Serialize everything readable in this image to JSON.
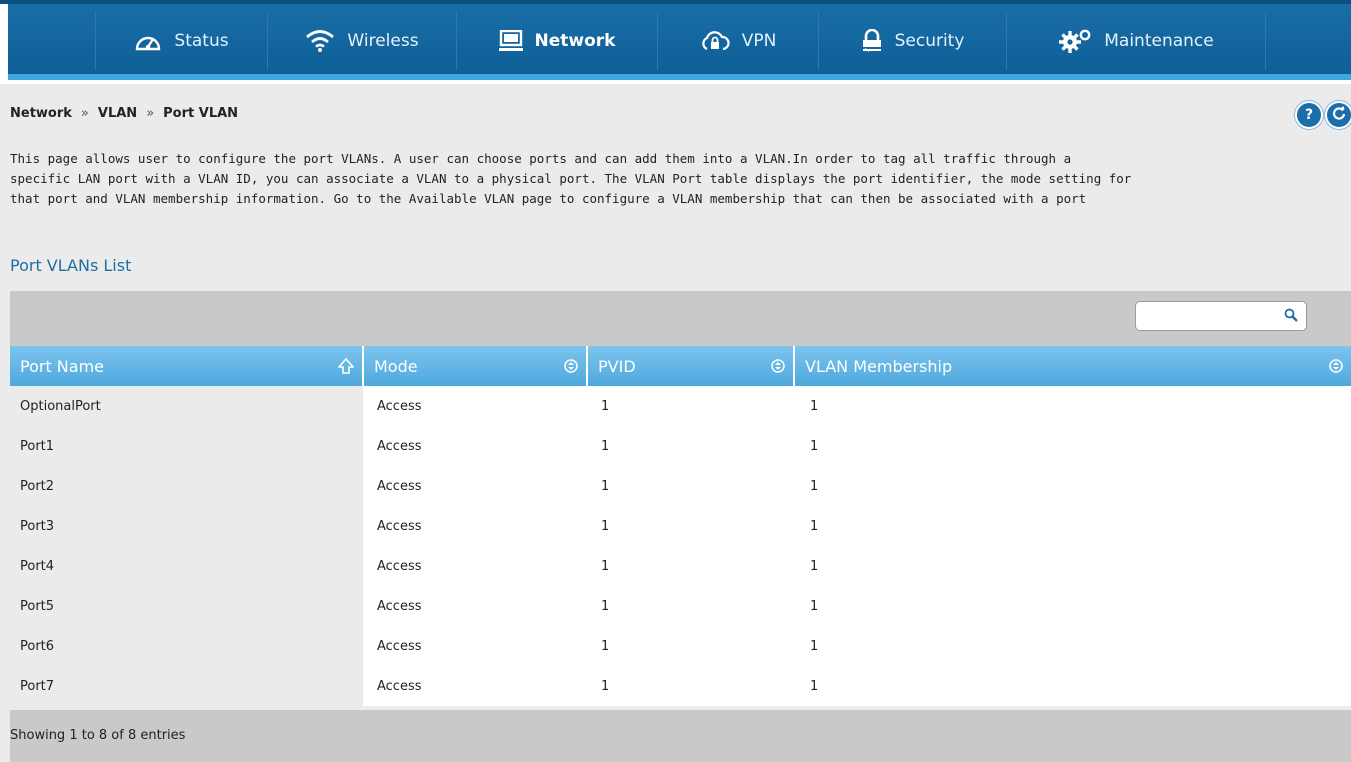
{
  "nav": {
    "items": [
      {
        "label": "Status",
        "icon": "dashboard-icon",
        "active": false
      },
      {
        "label": "Wireless",
        "icon": "wifi-icon",
        "active": false
      },
      {
        "label": "Network",
        "icon": "computer-icon",
        "active": true
      },
      {
        "label": "VPN",
        "icon": "cloud-lock-icon",
        "active": false
      },
      {
        "label": "Security",
        "icon": "padlock-icon",
        "active": false
      },
      {
        "label": "Maintenance",
        "icon": "gears-icon",
        "active": false
      }
    ]
  },
  "breadcrumb": {
    "items": [
      "Network",
      "VLAN",
      "Port VLAN"
    ],
    "separator": "»"
  },
  "help_button": {
    "label": "?"
  },
  "description": {
    "lines": [
      "This page allows user to configure the port VLANs. A user can choose ports and can add them into a VLAN.In order to tag all traffic through a",
      "specific LAN port with a VLAN ID, you can associate a VLAN to a physical port. The VLAN Port table displays the port identifier, the mode setting for",
      "that port and VLAN membership information. Go to the Available VLAN page to configure a VLAN membership that can then be associated with a port"
    ]
  },
  "section_title": "Port VLANs List",
  "search": {
    "value": "",
    "placeholder": ""
  },
  "table": {
    "columns": [
      "Port Name",
      "Mode",
      "PVID",
      "VLAN Membership"
    ],
    "rows": [
      {
        "port": "OptionalPort",
        "mode": "Access",
        "pvid": "1",
        "vlan": "1"
      },
      {
        "port": "Port1",
        "mode": "Access",
        "pvid": "1",
        "vlan": "1"
      },
      {
        "port": "Port2",
        "mode": "Access",
        "pvid": "1",
        "vlan": "1"
      },
      {
        "port": "Port3",
        "mode": "Access",
        "pvid": "1",
        "vlan": "1"
      },
      {
        "port": "Port4",
        "mode": "Access",
        "pvid": "1",
        "vlan": "1"
      },
      {
        "port": "Port5",
        "mode": "Access",
        "pvid": "1",
        "vlan": "1"
      },
      {
        "port": "Port6",
        "mode": "Access",
        "pvid": "1",
        "vlan": "1"
      },
      {
        "port": "Port7",
        "mode": "Access",
        "pvid": "1",
        "vlan": "1"
      }
    ]
  },
  "footer": {
    "entries_text": "Showing 1 to 8 of 8 entries"
  },
  "colors": {
    "nav_bg": "#1264a0",
    "nav_accent": "#3fa9df",
    "header_bg": "#5aaee2",
    "title_color": "#1e6ea0",
    "panel_bg": "#ebebeb",
    "toolbar_bg": "#c9c9c9"
  }
}
